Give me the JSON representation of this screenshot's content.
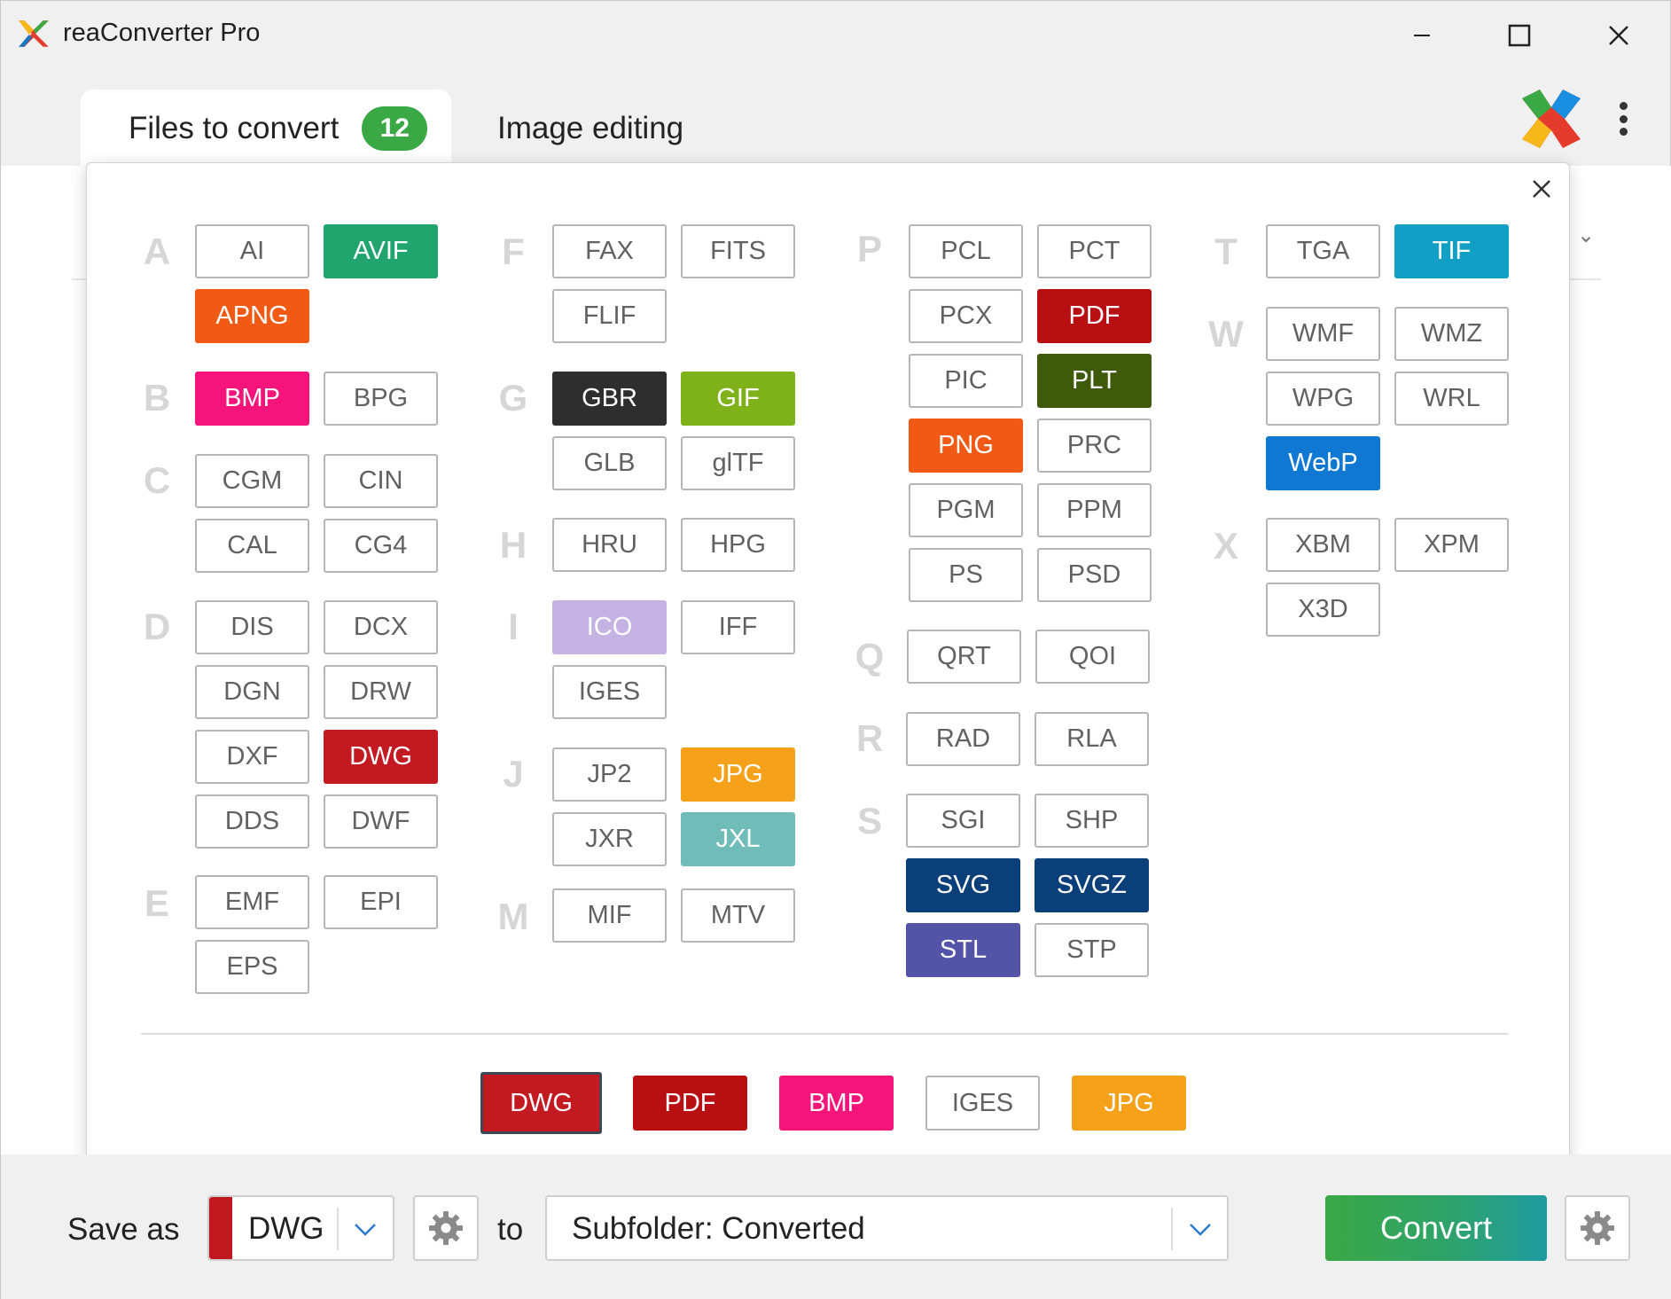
{
  "app": {
    "title": "reaConverter Pro"
  },
  "tabs": [
    {
      "label": "Files to convert",
      "badge": "12"
    },
    {
      "label": "Image editing"
    }
  ],
  "groups": [
    {
      "letter": "A",
      "formats": [
        {
          "label": "AI"
        },
        {
          "label": "AVIF",
          "color": "#20a56f"
        },
        {
          "label": "APNG",
          "color": "#f05a14"
        }
      ]
    },
    {
      "letter": "B",
      "formats": [
        {
          "label": "BMP",
          "color": "#f5157a"
        },
        {
          "label": "BPG"
        }
      ]
    },
    {
      "letter": "C",
      "formats": [
        {
          "label": "CGM"
        },
        {
          "label": "CIN"
        },
        {
          "label": "CAL"
        },
        {
          "label": "CG4"
        }
      ]
    },
    {
      "letter": "D",
      "formats": [
        {
          "label": "DIS"
        },
        {
          "label": "DCX"
        },
        {
          "label": "DGN"
        },
        {
          "label": "DRW"
        },
        {
          "label": "DXF"
        },
        {
          "label": "DWG",
          "color": "#c31a22"
        },
        {
          "label": "DDS"
        },
        {
          "label": "DWF"
        }
      ]
    },
    {
      "letter": "E",
      "formats": [
        {
          "label": "EMF"
        },
        {
          "label": "EPI"
        },
        {
          "label": "EPS"
        }
      ]
    },
    {
      "letter": "F",
      "formats": [
        {
          "label": "FAX"
        },
        {
          "label": "FITS"
        },
        {
          "label": "FLIF"
        }
      ]
    },
    {
      "letter": "G",
      "formats": [
        {
          "label": "GBR",
          "color": "#2e2e2e"
        },
        {
          "label": "GIF",
          "color": "#7fb11a"
        },
        {
          "label": "GLB"
        },
        {
          "label": "glTF"
        }
      ]
    },
    {
      "letter": "H",
      "formats": [
        {
          "label": "HRU"
        },
        {
          "label": "HPG"
        }
      ]
    },
    {
      "letter": "I",
      "formats": [
        {
          "label": "ICO",
          "color": "#c4b2e3"
        },
        {
          "label": "IFF"
        },
        {
          "label": "IGES"
        }
      ]
    },
    {
      "letter": "J",
      "formats": [
        {
          "label": "JP2"
        },
        {
          "label": "JPG",
          "color": "#f6a11a"
        },
        {
          "label": "JXR"
        },
        {
          "label": "JXL",
          "color": "#6fbcb8"
        }
      ]
    },
    {
      "letter": "M",
      "formats": [
        {
          "label": "MIF"
        },
        {
          "label": "MTV"
        }
      ]
    },
    {
      "letter": "P",
      "formats": [
        {
          "label": "PCL"
        },
        {
          "label": "PCT"
        },
        {
          "label": "PCX"
        },
        {
          "label": "PDF",
          "color": "#b70f12"
        },
        {
          "label": "PIC"
        },
        {
          "label": "PLT",
          "color": "#3f5a0a"
        },
        {
          "label": "PNG",
          "color": "#f05a14"
        },
        {
          "label": "PRC"
        },
        {
          "label": "PGM"
        },
        {
          "label": "PPM"
        },
        {
          "label": "PS"
        },
        {
          "label": "PSD"
        }
      ]
    },
    {
      "letter": "Q",
      "formats": [
        {
          "label": "QRT"
        },
        {
          "label": "QOI"
        }
      ]
    },
    {
      "letter": "R",
      "formats": [
        {
          "label": "RAD"
        },
        {
          "label": "RLA"
        }
      ]
    },
    {
      "letter": "S",
      "formats": [
        {
          "label": "SGI"
        },
        {
          "label": "SHP"
        },
        {
          "label": "SVG",
          "color": "#0a3f7a"
        },
        {
          "label": "SVGZ",
          "color": "#0a3f7a"
        },
        {
          "label": "STL",
          "color": "#5353a8"
        },
        {
          "label": "STP"
        }
      ]
    },
    {
      "letter": "T",
      "formats": [
        {
          "label": "TGA"
        },
        {
          "label": "TIF",
          "color": "#129fc6"
        }
      ]
    },
    {
      "letter": "W",
      "formats": [
        {
          "label": "WMF"
        },
        {
          "label": "WMZ"
        },
        {
          "label": "WPG"
        },
        {
          "label": "WRL"
        },
        {
          "label": "WebP",
          "color": "#0f78d2"
        }
      ]
    },
    {
      "letter": "X",
      "formats": [
        {
          "label": "XBM"
        },
        {
          "label": "XPM"
        },
        {
          "label": "X3D"
        }
      ]
    }
  ],
  "recent": [
    {
      "label": "DWG",
      "color": "#c31a22",
      "selected": true
    },
    {
      "label": "PDF",
      "color": "#b70f12"
    },
    {
      "label": "BMP",
      "color": "#f5157a"
    },
    {
      "label": "IGES"
    },
    {
      "label": "JPG",
      "color": "#f6a11a"
    }
  ],
  "bottom": {
    "save_as_label": "Save as",
    "format_value": "DWG",
    "to_label": "to",
    "destination": "Subfolder: Converted",
    "convert_label": "Convert"
  }
}
